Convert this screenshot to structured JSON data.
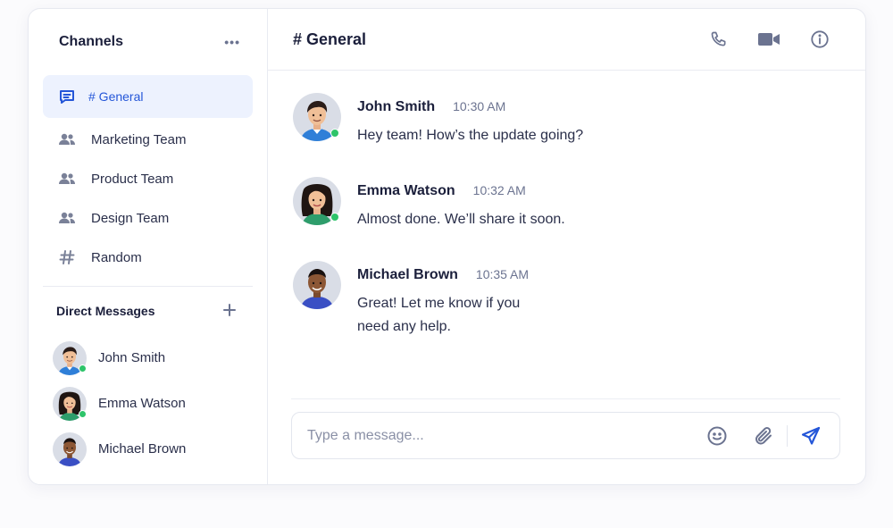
{
  "sidebar": {
    "title": "Channels",
    "more_icon": "more-horizontal-icon",
    "channels": [
      {
        "label": "# General",
        "icon": "chat-icon",
        "active": true
      },
      {
        "label": "Marketing Team",
        "icon": "users-icon"
      },
      {
        "label": "Product Team",
        "icon": "users-icon"
      },
      {
        "label": "Design Team",
        "icon": "users-icon"
      },
      {
        "label": "Random",
        "icon": "hash-icon"
      }
    ],
    "dm_title": "Direct Messages",
    "dm_add_icon": "plus-icon",
    "direct_messages": [
      {
        "name": "John Smith",
        "online": true
      },
      {
        "name": "Emma Watson",
        "online": true
      },
      {
        "name": "Michael Brown",
        "online": false
      }
    ]
  },
  "main": {
    "title": "# General",
    "header_icons": [
      "phone-icon",
      "video-icon",
      "info-icon"
    ],
    "messages": [
      {
        "author": "John Smith",
        "time": "10:30 AM",
        "text": "Hey team! How’s the update going?",
        "online": true
      },
      {
        "author": "Emma Watson",
        "time": "10:32 AM",
        "text": "Almost done. We’ll share it soon.",
        "online": true
      },
      {
        "author": "Michael Brown",
        "time": "10:35 AM",
        "text": "Great! Let me know if you need any help.",
        "online": false
      }
    ],
    "composer": {
      "placeholder": "Type a message...",
      "icons": [
        "emoji-icon",
        "attach-icon",
        "send-icon"
      ]
    }
  },
  "colors": {
    "accent": "#2456d8",
    "active_bg": "#edf2fe",
    "online": "#2ec46a"
  }
}
